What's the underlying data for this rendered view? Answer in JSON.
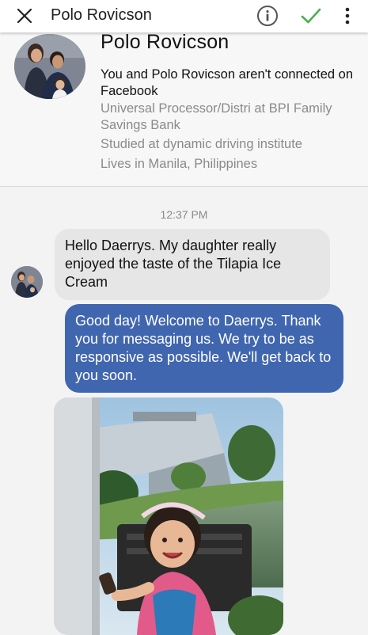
{
  "header": {
    "title": "Polo Rovicson",
    "close_icon": "close-icon",
    "info_icon": "info-icon",
    "check_icon": "check-icon",
    "more_icon": "more-vertical-icon",
    "accent_color": "#4caf50"
  },
  "profile": {
    "name": "Polo Rovicson",
    "connection": "You and Polo Rovicson aren't connected on Facebook",
    "details": [
      "Universal Processor/Distri at BPI Family Savings Bank",
      "Studied at dynamic driving institute",
      "Lives in Manila, Philippines"
    ]
  },
  "chat": {
    "timestamp": "12:37 PM",
    "messages": [
      {
        "direction": "incoming",
        "text": "Hello Daerrys. My daughter really enjoyed the taste of the Tilapia Ice Cream"
      },
      {
        "direction": "outgoing",
        "text": "Good day! Welcome to Daerrys. Thank you for messaging us. We try to be as responsive as possible. We'll get back to you soon."
      }
    ],
    "outgoing_color": "#4166b0",
    "incoming_color": "#e6e6e6"
  }
}
